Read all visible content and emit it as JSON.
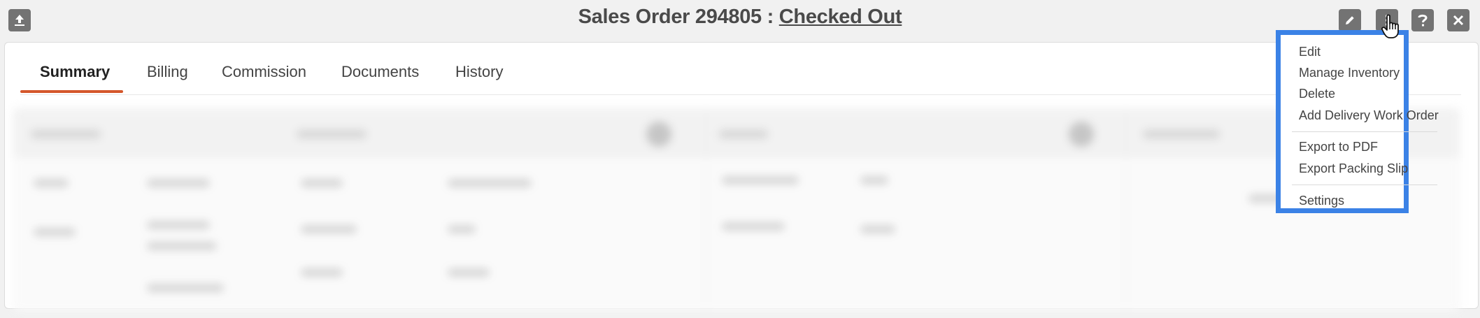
{
  "header": {
    "title_prefix": "Sales Order 294805 : ",
    "status": "Checked Out"
  },
  "icons": {
    "upload": "upload-icon",
    "edit": "pencil-icon",
    "more": "more-icon",
    "help": "help-icon",
    "close": "close-icon",
    "cursor": "hand-pointer-icon"
  },
  "tabs": [
    {
      "label": "Summary",
      "active": true
    },
    {
      "label": "Billing",
      "active": false
    },
    {
      "label": "Commission",
      "active": false
    },
    {
      "label": "Documents",
      "active": false
    },
    {
      "label": "History",
      "active": false
    }
  ],
  "menu": {
    "items": [
      "Edit",
      "Manage Inventory",
      "Delete",
      "Add Delivery Work Order",
      "Export to PDF",
      "Export Packing Slip",
      "Settings"
    ]
  },
  "colors": {
    "accent": "#d4572b",
    "highlight": "#3b82e6",
    "header_buttons": "#737373"
  }
}
